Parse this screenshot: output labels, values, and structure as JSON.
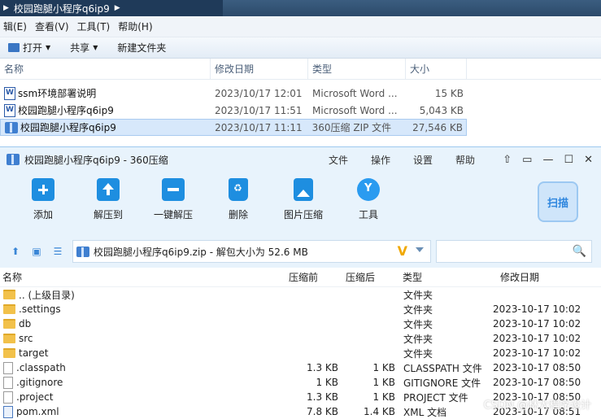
{
  "explorer": {
    "breadcrumb": "校园跑腿小程序q6ip9",
    "menu": [
      "辑(E)",
      "查看(V)",
      "工具(T)",
      "帮助(H)"
    ],
    "toolbar": {
      "open": "打开",
      "share": "共享",
      "new_folder": "新建文件夹"
    },
    "columns": {
      "name": "名称",
      "date": "修改日期",
      "type": "类型",
      "size": "大小"
    },
    "files": [
      {
        "name": "ssm环境部署说明",
        "date": "2023/10/17 12:01",
        "type": "Microsoft Word ...",
        "size": "15 KB",
        "icon": "word-doc-icon"
      },
      {
        "name": "校园跑腿小程序q6ip9",
        "date": "2023/10/17 11:51",
        "type": "Microsoft Word ...",
        "size": "5,043 KB",
        "icon": "word-doc-icon"
      },
      {
        "name": "校园跑腿小程序q6ip9",
        "date": "2023/10/17 11:11",
        "type": "360压缩 ZIP 文件",
        "size": "27,546 KB",
        "icon": "zip-archive-icon",
        "selected": true
      }
    ]
  },
  "zip": {
    "title": "校园跑腿小程序q6ip9 - 360压缩",
    "menus": [
      "文件",
      "操作",
      "设置",
      "帮助"
    ],
    "tools": [
      "添加",
      "解压到",
      "一键解压",
      "删除",
      "图片压缩",
      "工具"
    ],
    "scan_label": "扫描",
    "path_text": "校园跑腿小程序q6ip9.zip - 解包大小为 52.6 MB",
    "columns": {
      "name": "名称",
      "packed": "压缩前",
      "compressed": "压缩后",
      "type": "类型",
      "date": "修改日期"
    },
    "rows": [
      {
        "name": ".. (上级目录)",
        "s1": "",
        "s2": "",
        "type": "文件夹",
        "date": "",
        "icon": "folder"
      },
      {
        "name": ".settings",
        "s1": "",
        "s2": "",
        "type": "文件夹",
        "date": "2023-10-17 10:02",
        "icon": "folder"
      },
      {
        "name": "db",
        "s1": "",
        "s2": "",
        "type": "文件夹",
        "date": "2023-10-17 10:02",
        "icon": "folder"
      },
      {
        "name": "src",
        "s1": "",
        "s2": "",
        "type": "文件夹",
        "date": "2023-10-17 10:02",
        "icon": "folder"
      },
      {
        "name": "target",
        "s1": "",
        "s2": "",
        "type": "文件夹",
        "date": "2023-10-17 10:02",
        "icon": "folder"
      },
      {
        "name": ".classpath",
        "s1": "1.3 KB",
        "s2": "1 KB",
        "type": "CLASSPATH 文件",
        "date": "2023-10-17 08:50",
        "icon": "file"
      },
      {
        "name": ".gitignore",
        "s1": "1 KB",
        "s2": "1 KB",
        "type": "GITIGNORE 文件",
        "date": "2023-10-17 08:50",
        "icon": "file"
      },
      {
        "name": ".project",
        "s1": "1.3 KB",
        "s2": "1 KB",
        "type": "PROJECT 文件",
        "date": "2023-10-17 08:50",
        "icon": "file"
      },
      {
        "name": "pom.xml",
        "s1": "7.8 KB",
        "s2": "1.4 KB",
        "type": "XML 文档",
        "date": "2023-10-17 08:51",
        "icon": "xml"
      }
    ],
    "watermark": "CSDN @林大程序设计"
  }
}
